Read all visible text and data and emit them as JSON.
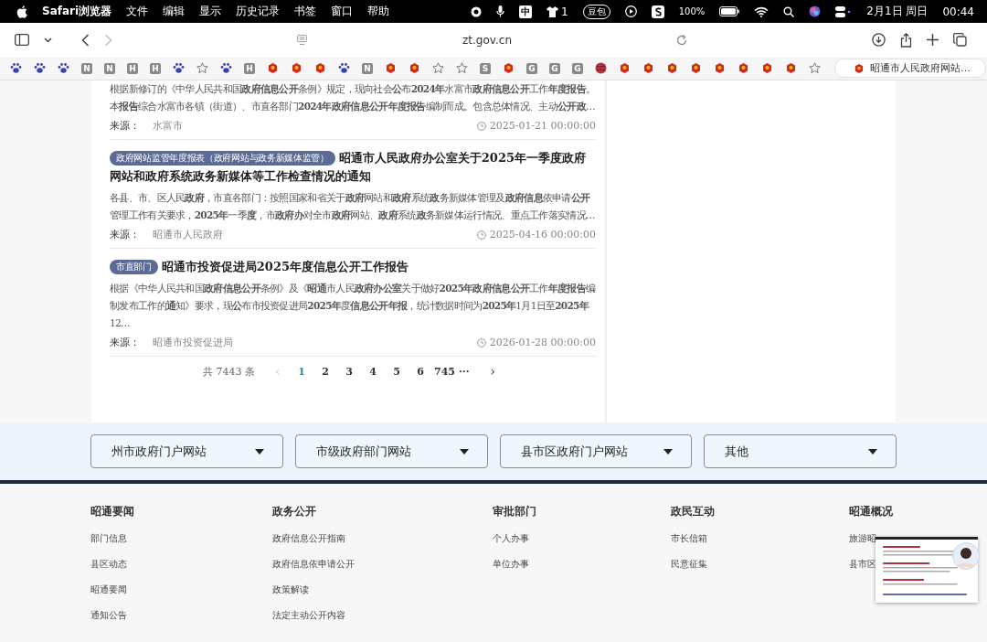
{
  "menu_bar": {
    "app_name": "Safari浏览器",
    "menus": [
      "文件",
      "编辑",
      "显示",
      "历史记录",
      "书签",
      "窗口",
      "帮助"
    ],
    "status": {
      "input_method": "中",
      "shirt_count": "1",
      "doubao": "豆包",
      "battery": "100%",
      "date": "2月1日 周日",
      "time": "00:44"
    }
  },
  "toolbar": {
    "address": "zt.gov.cn",
    "back": {
      "disabled": false
    },
    "forward": {
      "disabled": true
    }
  },
  "bookmarks": [
    {
      "kind": "paw"
    },
    {
      "kind": "paw"
    },
    {
      "kind": "paw"
    },
    {
      "kind": "letter",
      "label": "N"
    },
    {
      "kind": "letter",
      "label": "N"
    },
    {
      "kind": "letter",
      "label": "H"
    },
    {
      "kind": "letter",
      "label": "H"
    },
    {
      "kind": "paw"
    },
    {
      "kind": "star"
    },
    {
      "kind": "paw"
    },
    {
      "kind": "letter",
      "label": "H"
    },
    {
      "kind": "emblem"
    },
    {
      "kind": "emblem"
    },
    {
      "kind": "emblem"
    },
    {
      "kind": "paw"
    },
    {
      "kind": "letter",
      "label": "N"
    },
    {
      "kind": "emblem"
    },
    {
      "kind": "emblem"
    },
    {
      "kind": "star"
    },
    {
      "kind": "star"
    },
    {
      "kind": "letter",
      "label": "S"
    },
    {
      "kind": "emblem"
    },
    {
      "kind": "letter",
      "label": "G"
    },
    {
      "kind": "letter",
      "label": "G"
    },
    {
      "kind": "letter",
      "label": "G"
    },
    {
      "kind": "ball"
    },
    {
      "kind": "emblem"
    },
    {
      "kind": "emblem"
    },
    {
      "kind": "emblem"
    },
    {
      "kind": "emblem"
    },
    {
      "kind": "emblem"
    },
    {
      "kind": "emblem"
    },
    {
      "kind": "emblem"
    },
    {
      "kind": "emblem"
    },
    {
      "kind": "star"
    }
  ],
  "tab": {
    "title": "昭通市人民政府网站…"
  },
  "results": [
    {
      "snippet": "根据新修订的《中华人民共和国**政府信息公开**条例》规定，现向社会**公**布**2024年**水富市**政府信息公开**工作**年度报告**。本**报告**综合水富市各镇（街道）、市直各部门**2024年政府信息公开年度报告**编制而成。包含总体情况、主动**公开政**…",
      "source_label": "来源：",
      "source": "水富市",
      "date": "2025-01-21 00:00:00"
    },
    {
      "tag": "政府网站监管年度报表（政府网站与政务新媒体监管）",
      "title": "**昭通**市人民**政府办公室**关于**2025**年一季度**政府**网站和**政府**系统政务新媒体等工作检查情况的通知",
      "snippet": "各县、市、区人民**政府**，市直各部门：按照国家和省关于**政府**网站和**政府**系统**政**务新媒体管理及**政府信息**依申请**公开**管理工作有关要求，**2025年**一季**度**，市**政府办**对全市**政府**网站、**政府**系统**政**务新媒体运行情况、重点工作落实情况…",
      "source_label": "来源：",
      "source": "昭通市人民政府",
      "date": "2025-04-16 00:00:00"
    },
    {
      "tag": "市直部门",
      "title": "**昭通**市投资促进局**2025年度信息公开工作报告**",
      "snippet": "根据《中华人民共和国**政府信息公开**条例》及《**昭通**市人民**政府办公室**关于做好**2025年政府信息公开**工作**年度报告**编制发布工作的**通**知》要求，现**公**布市投资促进局**2025年**度**信息公开年报**，统计数据时间为**2025年**1月1日至**2025年**12…",
      "source_label": "来源：",
      "source": "昭通市投资促进局",
      "date": "2026-01-28 00:00:00"
    }
  ],
  "pagination": {
    "total": "共 7443 条",
    "prev": {
      "label": "‹",
      "disabled": true
    },
    "pages": [
      {
        "label": "1",
        "selected": true
      },
      {
        "label": "2",
        "selected": false
      },
      {
        "label": "3",
        "selected": false
      },
      {
        "label": "4",
        "selected": false
      },
      {
        "label": "5",
        "selected": false
      },
      {
        "label": "6",
        "selected": false
      },
      {
        "label": "745",
        "selected": false
      }
    ],
    "ellipsis": "···",
    "next": {
      "label": "›",
      "disabled": false
    }
  },
  "site_links": [
    "州市政府门户网站",
    "市级政府部门网站",
    "县市区政府门户网站",
    "其他"
  ],
  "footer": [
    {
      "heading": "昭通要闻",
      "links": [
        "部门信息",
        "县区动态",
        "昭通要闻",
        "通知公告"
      ]
    },
    {
      "heading": "政务公开",
      "links": [
        "政府信息公开指南",
        "政府信息依申请公开",
        "政策解读",
        "法定主动公开内容"
      ]
    },
    {
      "heading": "审批部门",
      "links": [
        "个人办事",
        "单位办事"
      ]
    },
    {
      "heading": "政民互动",
      "links": [
        "市长信箱",
        "民意征集"
      ]
    },
    {
      "heading": "昭通概况",
      "links": [
        "旅游昭",
        "县市区"
      ]
    }
  ]
}
